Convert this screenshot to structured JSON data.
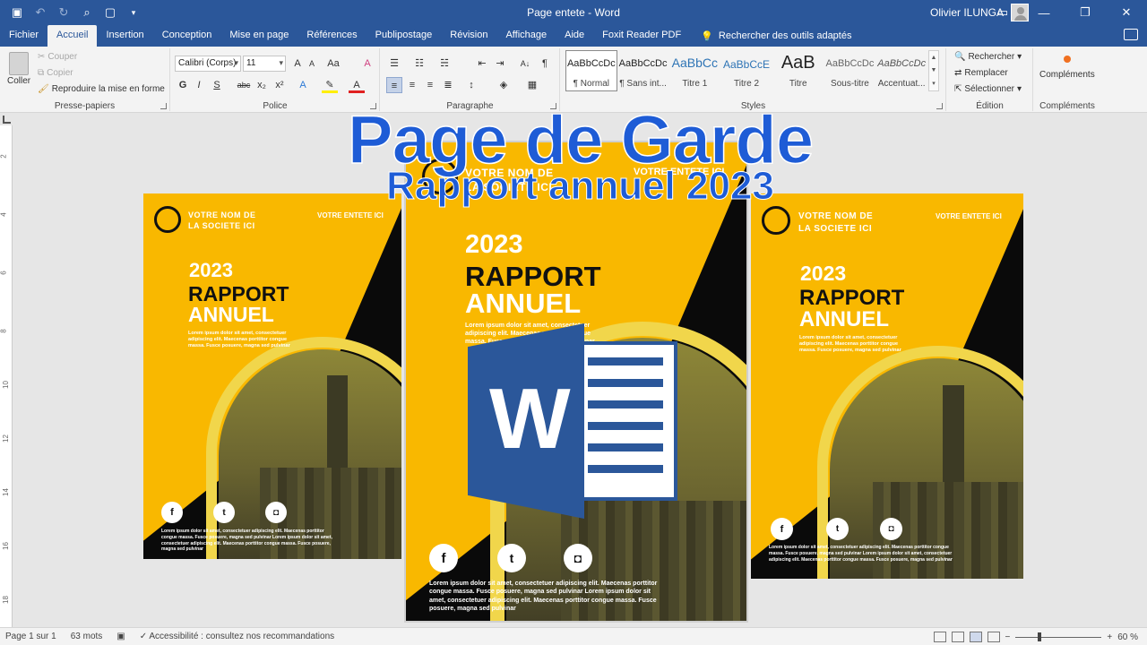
{
  "window": {
    "title": "Page entete  -  Word",
    "user": "Olivier ILUNGA",
    "controls": [
      "ribbon-display-icon",
      "minimize-icon",
      "restore-icon",
      "close-icon"
    ]
  },
  "qat": [
    "save-icon",
    "undo-icon",
    "redo-icon",
    "print-preview-icon",
    "new-doc-icon",
    "customize-icon"
  ],
  "tabs": [
    {
      "label": "Fichier"
    },
    {
      "label": "Accueil",
      "active": true
    },
    {
      "label": "Insertion"
    },
    {
      "label": "Conception"
    },
    {
      "label": "Mise en page"
    },
    {
      "label": "Références"
    },
    {
      "label": "Publipostage"
    },
    {
      "label": "Révision"
    },
    {
      "label": "Affichage"
    },
    {
      "label": "Aide"
    },
    {
      "label": "Foxit Reader PDF"
    }
  ],
  "tellme": "Rechercher des outils adaptés",
  "ribbon": {
    "clipboard": {
      "label": "Presse-papiers",
      "paste": "Coller",
      "cut": "Couper",
      "copy": "Copier",
      "format_painter": "Reproduire la mise en forme"
    },
    "font": {
      "label": "Police",
      "name": "Calibri (Corps)",
      "size": "11",
      "bold": "G",
      "italic": "I",
      "underline": "S",
      "strike": "abc",
      "subscript": "x₂",
      "superscript": "x²"
    },
    "paragraph": {
      "label": "Paragraphe"
    },
    "styles": {
      "label": "Styles",
      "items": [
        {
          "preview": "AaBbCcDc",
          "name": "¶ Normal",
          "selected": true
        },
        {
          "preview": "AaBbCcDc",
          "name": "¶ Sans int..."
        },
        {
          "preview": "AaBbCc",
          "name": "Titre 1"
        },
        {
          "preview": "AaBbCcE",
          "name": "Titre 2"
        },
        {
          "preview": "AaB",
          "name": "Titre"
        },
        {
          "preview": "AaBbCcDc",
          "name": "Sous-titre"
        },
        {
          "preview": "AaBbCcDc",
          "name": "Accentuat..."
        }
      ]
    },
    "editing": {
      "label": "Édition",
      "find": "Rechercher",
      "replace": "Remplacer",
      "select": "Sélectionner"
    },
    "addins": {
      "label": "Compléments",
      "button": "Compléments"
    }
  },
  "overlay": {
    "title": "Page de Garde",
    "subtitle": "Rapport annuel  2023"
  },
  "cover": {
    "company": "VOTRE NOM DE\nLA SOCIETE ICI",
    "entete": "VOTRE ENTETE ICI",
    "year": "2023",
    "rapport": "RAPPORT",
    "annuel": "ANNUEL",
    "lorem": "Lorem ipsum dolor sit amet, consectetuer adipiscing elit. Maecenas porttitor congue massa. Fusce posuere, magna sed pulvinar",
    "footer": "Lorem ipsum dolor sit amet, consectetuer adipiscing elit. Maecenas porttitor congue massa. Fusce posuere, magna sed pulvinar Lorem ipsum dolor sit amet, consectetuer adipiscing elit. Maecenas porttitor congue massa. Fusce posuere, magna sed pulvinar",
    "social_icons": [
      "facebook-icon",
      "twitter-icon",
      "instagram-icon"
    ],
    "colors": {
      "yellow": "#f9b800",
      "black": "#0a0a0a",
      "ring": "#f1d64b"
    }
  },
  "status": {
    "page": "Page 1 sur 1",
    "words": "63 mots",
    "accessibility": "Accessibilité : consultez nos recommandations",
    "zoom": "60 %",
    "zoom_level": 0.6
  }
}
